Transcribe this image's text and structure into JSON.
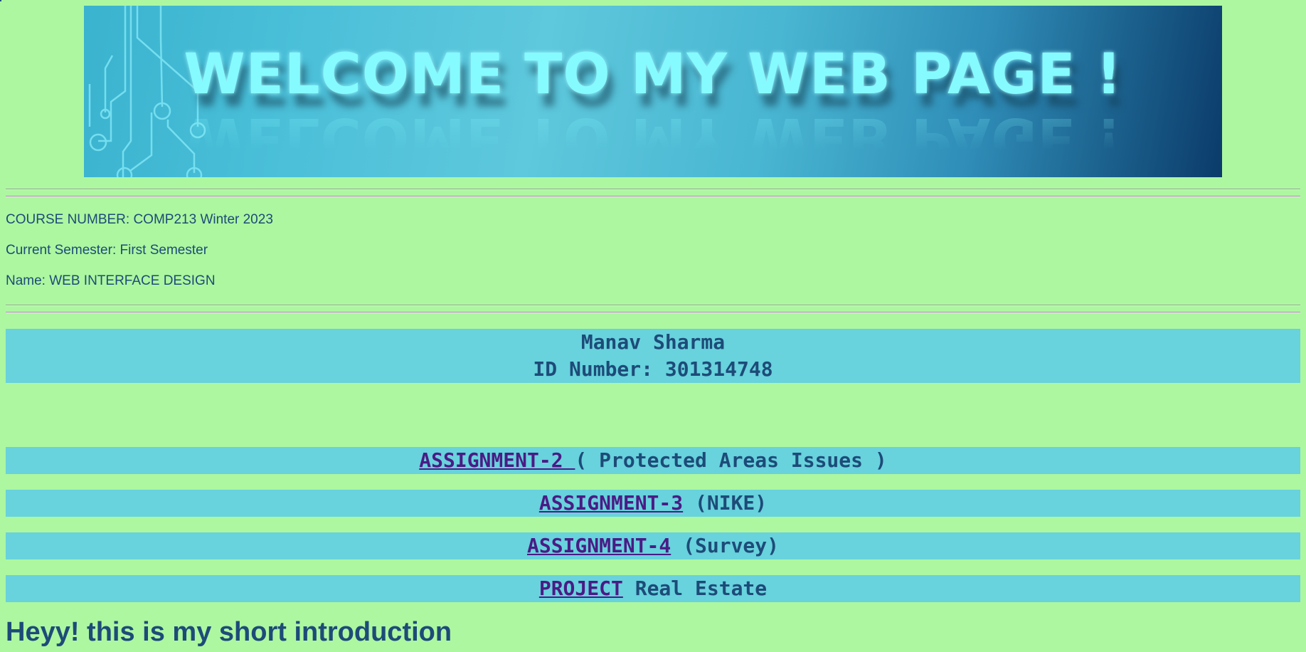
{
  "banner": {
    "title": "WELCOME TO MY WEB PAGE !"
  },
  "course": {
    "number_line": "COURSE NUMBER: COMP213 Winter 2023",
    "semester_line": "Current Semester: First Semester",
    "name_line": "Name: WEB INTERFACE DESIGN"
  },
  "student": {
    "name": "Manav Sharma",
    "id_line": "ID Number: 301314748"
  },
  "links": [
    {
      "link_text": "ASSIGNMENT-2 ",
      "suffix": "( Protected Areas Issues )"
    },
    {
      "link_text": "ASSIGNMENT-3",
      "suffix": " (NIKE)"
    },
    {
      "link_text": "ASSIGNMENT-4",
      "suffix": " (Survey)"
    },
    {
      "link_text": "PROJECT",
      "suffix": " Real Estate"
    }
  ],
  "intro": {
    "heading": "Heyy! this is my short introduction"
  },
  "colors": {
    "page_background": "#adf7a0",
    "text": "#1d4b78",
    "bar_background": "#68d2dd",
    "link": "#4a1b85",
    "banner_text": "#86fbff"
  }
}
